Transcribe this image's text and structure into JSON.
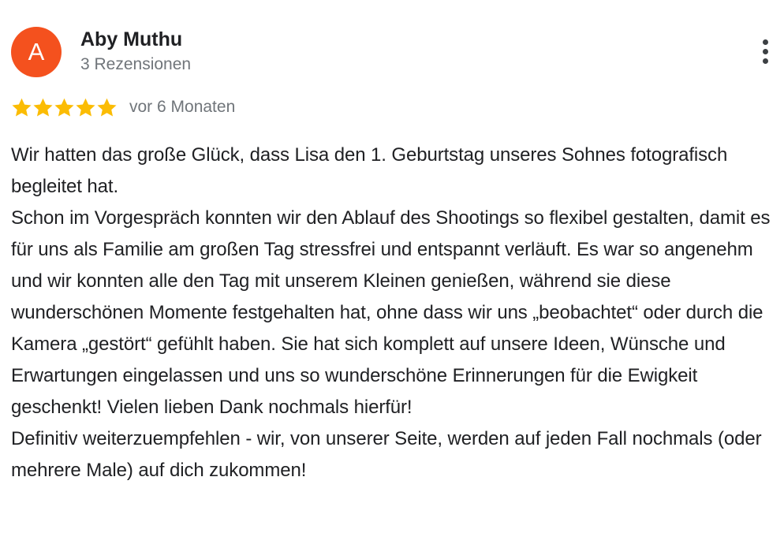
{
  "author": {
    "initial": "A",
    "name": "Aby Muthu",
    "review_count": "3 Rezensionen",
    "avatar_color": "#f4511e"
  },
  "menu": {
    "icon": "more-vert-icon"
  },
  "rating": {
    "stars": 5,
    "max_stars": 5,
    "star_color": "#fbbc04",
    "date": "vor 6 Monaten"
  },
  "review": {
    "paragraphs": [
      "Wir hatten das große Glück, dass Lisa den 1. Geburtstag unseres Sohnes fotografisch begleitet hat.",
      "Schon im Vorgespräch konnten wir den Ablauf des Shootings so flexibel gestalten, damit es für uns als Familie am großen Tag stressfrei und entspannt verläuft. Es war so angenehm und wir konnten alle den Tag mit unserem Kleinen genießen, während sie diese wunderschönen Momente festgehalten hat, ohne dass wir uns „beobachtet“ oder durch die Kamera „gestört“ gefühlt haben. Sie hat sich komplett auf unsere Ideen, Wünsche und Erwartungen eingelassen und uns so wunderschöne Erinnerungen für die Ewigkeit geschenkt! Vielen lieben Dank nochmals hierfür!",
      "Definitiv weiterzuempfehlen - wir, von unserer Seite, werden auf jeden Fall nochmals (oder mehrere Male) auf dich zukommen!"
    ]
  }
}
